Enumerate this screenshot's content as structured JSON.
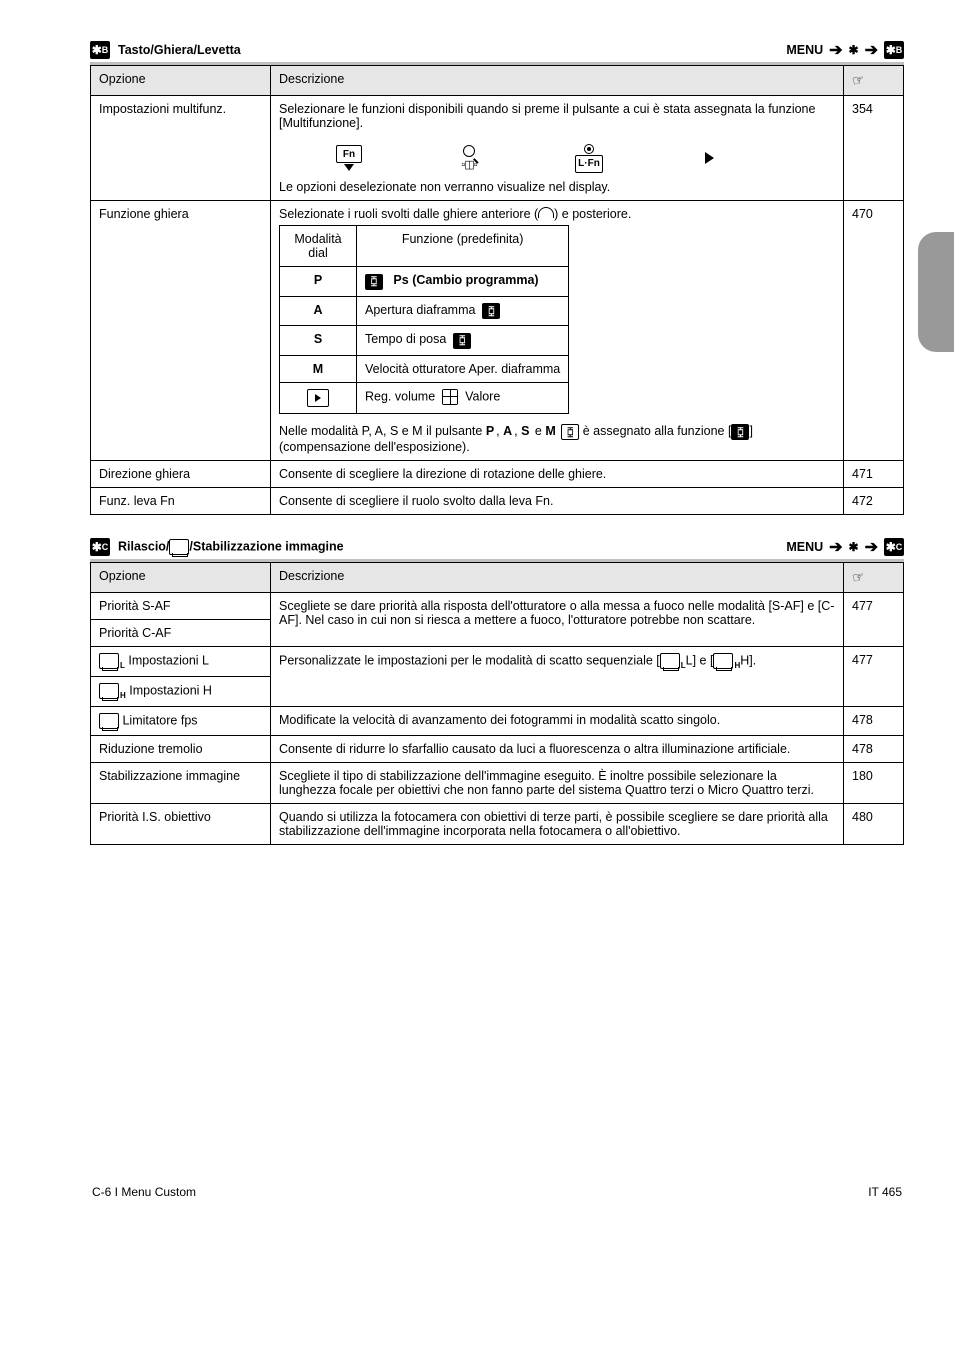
{
  "sectionB": {
    "badge": "✱B",
    "title": "Tasto/Ghiera/Levetta",
    "navMenu": "MENU",
    "navGear": "✱",
    "navBadge": "✱B",
    "headers": {
      "option": "Opzione",
      "desc": "Descrizione",
      "ref": "☞"
    },
    "rows": {
      "multiFn": {
        "label": "Impostazioni multifunz.",
        "desc_pre": "Selezionare le funzioni disponibili quando si preme il pulsante a cui è stata assegnata la funzione [Multifunzione].",
        "desc_post": "Le opzioni deselezionate non verranno visualize nel display.",
        "icons": [
          {
            "name": "fn-down-icon",
            "sub": ""
          },
          {
            "name": "magnify-multiview-icon",
            "sub": ""
          },
          {
            "name": "rec-lfn-icon",
            "sub": ""
          },
          {
            "name": "play-icon",
            "sub": ""
          }
        ],
        "ref": "354"
      },
      "dial": {
        "label": "Funzione ghiera",
        "desc_pre": "Selezionate i ruoli svolti dalle ghiere anteriore (",
        "desc_post": ") e posteriore.",
        "table": {
          "hdr": {
            "mode": "Modalità dial",
            "func": "Funzione (predefinita)"
          },
          "r1": {
            "mode": "P",
            "func_pre": "",
            "func_post": "  Ps (Cambio programma)"
          },
          "r2": {
            "mode": "A",
            "func": "Apertura diaframma"
          },
          "r3": {
            "mode": "S",
            "func": "Tempo di posa"
          },
          "r4": {
            "mode": "M",
            "func": "Velocità otturatore Aper. diaframma"
          },
          "r5": {
            "func": "Reg. volume",
            "func2": "Valore"
          },
          "note": "Nelle modalità P, A, S e M il pulsante ",
          "note2": " è assegnato alla funzione [",
          "note3": "] (compensazione dell'esposizione)."
        },
        "ref": "470"
      },
      "dialDir": {
        "label": "Direzione ghiera",
        "desc": "Consente di scegliere la direzione di rotazione delle ghiere.",
        "ref": "471"
      },
      "fnLever": {
        "label": "Funz. leva Fn",
        "desc": "Consente di scegliere il ruolo svolto dalla leva Fn.",
        "ref": "472"
      }
    }
  },
  "sectionC": {
    "badge": "✱C",
    "title": "Rilascio/",
    "title2": "/Stabilizzazione immagine",
    "navMenu": "MENU",
    "navGear": "✱",
    "navBadge": "✱C",
    "headers": {
      "option": "Opzione",
      "desc": "Descrizione",
      "ref": "☞"
    },
    "rows": {
      "sc": {
        "label": "Priorità S-AF",
        "label2": "Priorità C-AF",
        "desc": "Scegliete se dare priorità alla risposta dell'otturatore o alla messa a fuoco nelle modalità [S-AF] e [C-AF]. Nel caso in cui non si riesca a mettere a fuoco, l'otturatore potrebbe non scattare.",
        "ref": "477"
      },
      "lh": {
        "label1": " Impostazioni L",
        "label2": " Impostazioni H",
        "desc": "Personalizzate le impostazioni per le modalità di scatto sequenziale [",
        "desc_mid": "L] e [",
        "desc_post": "H].",
        "ref": "477"
      },
      "fps": {
        "label": " Limitatore fps",
        "desc": "Modificate la velocità di avanzamento dei fotogrammi in modalità scatto singolo.",
        "ref": "478"
      },
      "flicker": {
        "label": "Riduzione tremolio",
        "desc": "Consente di ridurre lo sfarfallio causato da luci a fluorescenza o altra illuminazione artificiale.",
        "ref": "478"
      },
      "is": {
        "label": "Stabilizzazione immagine",
        "desc": "Scegliete il tipo di stabilizzazione dell'immagine eseguito. È inoltre possibile selezionare la lunghezza focale per obiettivi che non fanno parte del sistema Quattro terzi o Micro Quattro terzi.",
        "ref": "180"
      },
      "lensIs": {
        "label": "Priorità I.S. obiettivo",
        "desc": "Quando si utilizza la fotocamera con obiettivi di terze parti, è possibile scegliere se dare priorità alla stabilizzazione dell'immagine incorporata nella fotocamera o all'obiettivo.",
        "ref": "480"
      }
    }
  },
  "footer": {
    "left": "C-6  I Menu Custom",
    "right": "IT  465"
  }
}
